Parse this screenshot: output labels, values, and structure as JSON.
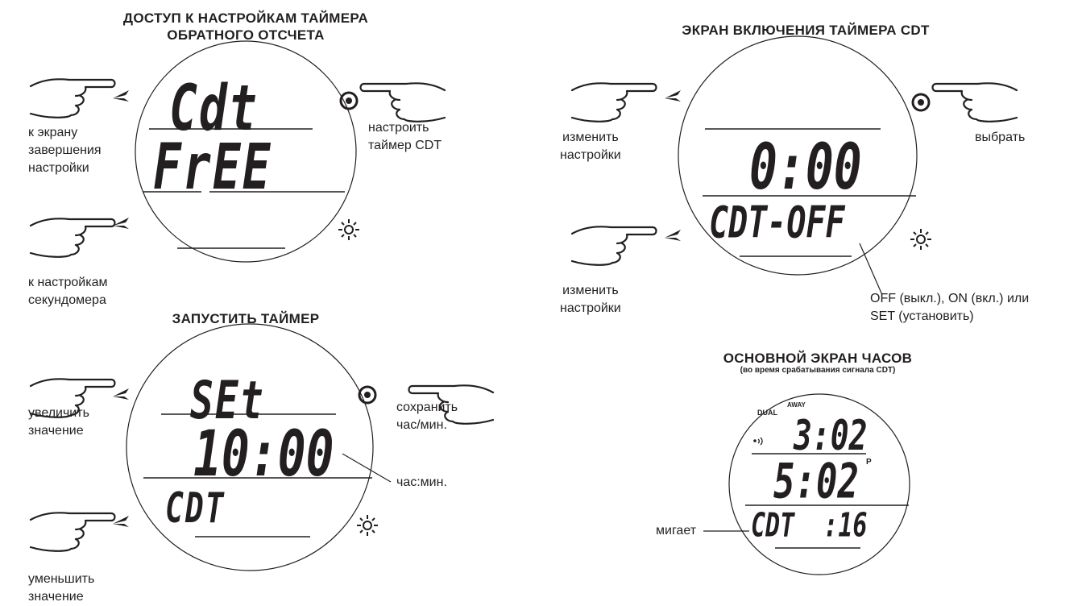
{
  "diagram": {
    "panel_cdt_access": {
      "title_line1": "ДОСТУП К НАСТРОЙКАМ ТАЙМЕРА",
      "title_line2": "ОБРАТНОГО ОТСЧЕТА",
      "lcd_top": "Cdt",
      "lcd_middle": "FrEE",
      "label_upper_left": "к экрану\nзавершения\nнастройки",
      "label_lower_left": "к настройкам\nсекундомера",
      "label_right": "настроить\nтаймер CDT"
    },
    "panel_start_timer": {
      "title": "ЗАПУСТИТЬ ТАЙМЕР",
      "lcd_top": "SEt",
      "lcd_middle": "10:00",
      "lcd_bottom": "CDT",
      "label_upper_left": "увеличить\nзначение",
      "label_lower_left": "уменьшить\nзначение",
      "label_right": "сохранить\nчас/мин.",
      "callout": "час:мин."
    },
    "panel_cdt_enable": {
      "title": "ЭКРАН ВКЛЮЧЕНИЯ ТАЙМЕРА CDT",
      "lcd_middle": "0:00",
      "lcd_bottom": "CDT-OFF",
      "label_upper_left": "изменить\nнастройки",
      "label_lower_left": "изменить\nнастройки",
      "label_right": "выбрать",
      "callout": "OFF (выкл.), ON (вкл.) или\nSET (установить)"
    },
    "panel_main_watch": {
      "title": "ОСНОВНОЙ ЭКРАН ЧАСОВ",
      "subtitle": "(во время срабатывания сигнала CDT)",
      "indicator_dual": "DUAL",
      "indicator_away": "AWAY",
      "indicator_pm": "P",
      "lcd_top": "3:02",
      "lcd_middle": "5:02",
      "lcd_bottom": "CDT  :16",
      "callout": "мигает"
    },
    "icons": [
      "hand-pointer-icon",
      "triangle-left-icon",
      "select-button-icon",
      "light-sun-icon",
      "sound-icon"
    ]
  }
}
